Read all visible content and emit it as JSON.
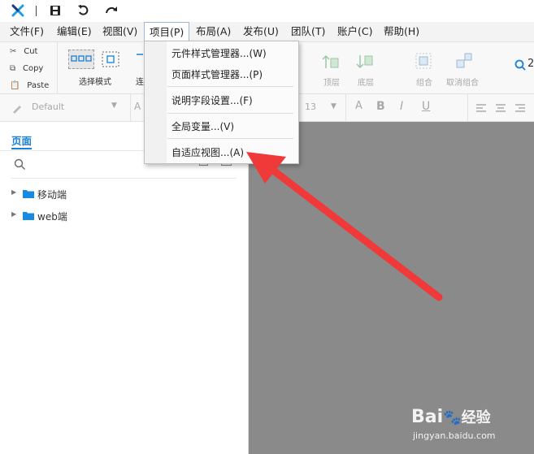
{
  "menubar": {
    "items": [
      "文件(F)",
      "编辑(E)",
      "视图(V)",
      "项目(P)",
      "布局(A)",
      "发布(U)",
      "团队(T)",
      "账户(C)",
      "帮助(H)"
    ]
  },
  "toolbar": {
    "cut": "Cut",
    "copy": "Copy",
    "paste": "Paste",
    "select_mode": "选择模式",
    "connect_partial": "连",
    "top_layer": "顶层",
    "bottom_layer": "底层",
    "group": "组合",
    "ungroup": "取消组合",
    "zoom_partial": "2"
  },
  "formatbar": {
    "style_value": "Default",
    "font_partial": "A",
    "font_size": "13",
    "bold": "B",
    "italic": "I",
    "underline": "U",
    "text_color": "A"
  },
  "pages_panel": {
    "tab_label": "页面",
    "folders": [
      "移动端",
      "web端"
    ]
  },
  "dropdown": {
    "items": [
      "元件样式管理器...(W)",
      "页面样式管理器...(P)",
      "说明字段设置...(F)",
      "全局变量...(V)",
      "自适应视图...(A)"
    ]
  },
  "watermark": {
    "brand": "Bai",
    "brand2": "经验",
    "url": "jingyan.baidu.com"
  },
  "colors": {
    "arrow": "#f03a3a",
    "accent": "#1a7fd6",
    "canvas": "#8a8a8a"
  }
}
